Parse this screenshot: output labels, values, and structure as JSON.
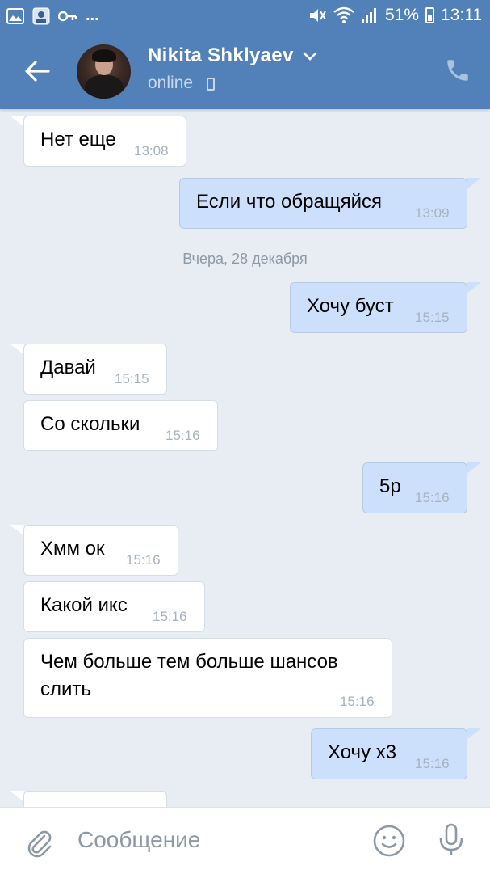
{
  "status_bar": {
    "left_icons": [
      "gallery-icon",
      "app-icon",
      "key-icon",
      "more-dots"
    ],
    "dots": "...",
    "battery_percent": "51%",
    "time": "13:11"
  },
  "header": {
    "contact_name": "Nikita Shklyaev",
    "status": "online",
    "colors": {
      "header_bg": "#5181b8",
      "chat_bg": "#e7edf3",
      "outgoing_bubble": "#cce0fb",
      "incoming_bubble": "#ffffff"
    }
  },
  "chat": {
    "messages": [
      {
        "dir": "in",
        "text": "Нет еще",
        "time": "13:08"
      },
      {
        "dir": "out",
        "text": "Если что обращяйся",
        "time": "13:09"
      },
      {
        "dir": "out",
        "text": "Хочу буст",
        "time": "15:15"
      },
      {
        "dir": "in",
        "text": "Давай",
        "time": "15:15"
      },
      {
        "dir": "in",
        "text": "Со скольки",
        "time": "15:16"
      },
      {
        "dir": "out",
        "text": "5р",
        "time": "15:16"
      },
      {
        "dir": "in",
        "text": "Хмм ок",
        "time": "15:16"
      },
      {
        "dir": "in",
        "text": "Какой икс",
        "time": "15:16"
      },
      {
        "dir": "in",
        "text": "Чем больше тем больше шансов слить",
        "time": "15:16"
      },
      {
        "dir": "out",
        "text": "Хочу х3",
        "time": "15:16"
      }
    ],
    "date_separator": "Вчера, 28 декабря"
  },
  "composer": {
    "placeholder": "Сообщение"
  }
}
